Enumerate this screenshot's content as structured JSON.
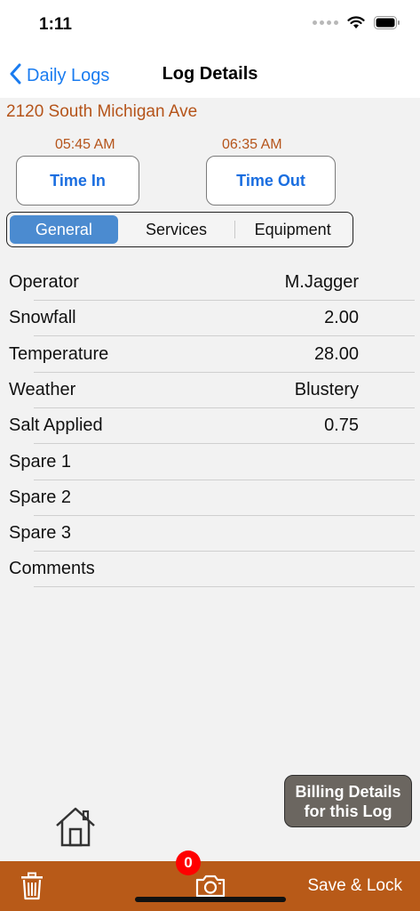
{
  "status": {
    "time": "1:11"
  },
  "nav": {
    "back_label": "Daily Logs",
    "title": "Log Details"
  },
  "log": {
    "address": "2120 South Michigan Ave",
    "time_in_value": "05:45 AM",
    "time_out_value": "06:35 AM",
    "time_in_label": "Time In",
    "time_out_label": "Time Out"
  },
  "tabs": [
    {
      "label": "General",
      "selected": true
    },
    {
      "label": "Services",
      "selected": false
    },
    {
      "label": "Equipment",
      "selected": false
    }
  ],
  "fields": [
    {
      "label": "Operator",
      "value": "M.Jagger"
    },
    {
      "label": "Snowfall",
      "value": "2.00"
    },
    {
      "label": "Temperature",
      "value": "28.00"
    },
    {
      "label": "Weather",
      "value": "Blustery"
    },
    {
      "label": "Salt Applied",
      "value": "0.75"
    },
    {
      "label": "Spare 1",
      "value": ""
    },
    {
      "label": "Spare 2",
      "value": ""
    },
    {
      "label": "Spare 3",
      "value": ""
    },
    {
      "label": "Comments",
      "value": ""
    }
  ],
  "billing": {
    "line1": "Billing Details",
    "line2": "for this Log"
  },
  "toolbar": {
    "photo_count": "0",
    "save_label": "Save & Lock"
  },
  "colors": {
    "accent": "#b85a18",
    "link": "#1a7cf0",
    "address": "#b5541a",
    "selected_tab": "#4b8bd0"
  },
  "icons": [
    "back-chevron-icon",
    "wifi-icon",
    "battery-icon",
    "home-icon",
    "trash-icon",
    "camera-icon"
  ]
}
